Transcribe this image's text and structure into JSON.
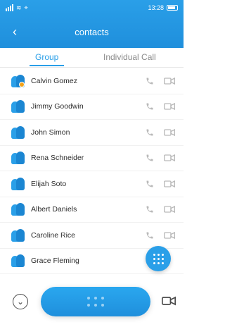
{
  "colors": {
    "primary": "#2a9fe8",
    "primary_dark": "#1b86d2",
    "badge": "#f3a21a",
    "muted": "#8a8a8a"
  },
  "status_bar": {
    "time": "13:28"
  },
  "header": {
    "title": "contacts",
    "back_icon": "back-arrow-icon"
  },
  "tabs": {
    "group_label": "Group",
    "individual_label": "Individual Call",
    "active": "Group"
  },
  "contacts": [
    {
      "name": "Calvin Gomez",
      "has_badge": true
    },
    {
      "name": "Jimmy Goodwin",
      "has_badge": false
    },
    {
      "name": "John Simon",
      "has_badge": false
    },
    {
      "name": "Rena Schneider",
      "has_badge": false
    },
    {
      "name": "Elijah Soto",
      "has_badge": false
    },
    {
      "name": "Albert Daniels",
      "has_badge": false
    },
    {
      "name": "Caroline Rice",
      "has_badge": false
    },
    {
      "name": "Grace Fleming",
      "has_badge": false
    }
  ],
  "bottom_bar": {
    "left_icon": "chevron-down-circle-icon",
    "center_icon": "dialpad-icon",
    "right_icon": "video-icon"
  },
  "fab": {
    "icon": "dialpad-icon"
  }
}
